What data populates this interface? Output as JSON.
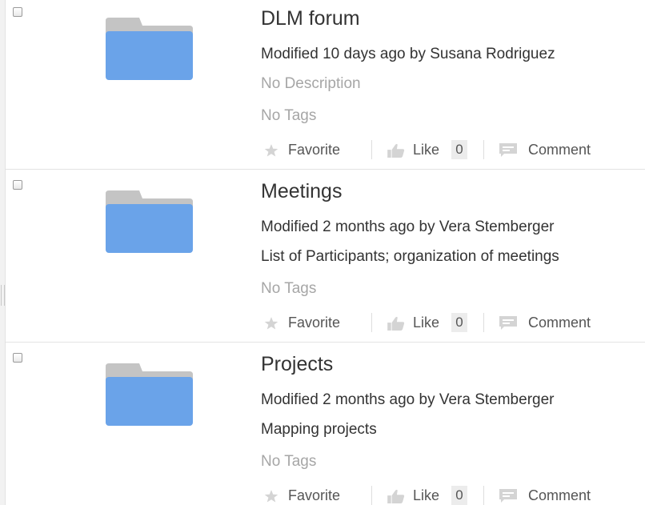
{
  "actions": {
    "favorite_label": "Favorite",
    "like_label": "Like",
    "comment_label": "Comment"
  },
  "colors": {
    "folder_front": "#6aa3e9",
    "folder_back": "#c4c4c4",
    "muted_text": "#a6a6a6"
  },
  "folders": [
    {
      "name": "DLM forum",
      "modified": "Modified 10 days ago by Susana Rodriguez",
      "description": "No Description",
      "tags": "No Tags",
      "like_count": "0"
    },
    {
      "name": "Meetings",
      "modified": "Modified 2 months ago by Vera Stemberger",
      "description": "List of Participants; organization of meetings",
      "tags": "No Tags",
      "like_count": "0"
    },
    {
      "name": "Projects",
      "modified": "Modified 2 months ago by Vera Stemberger",
      "description": "Mapping projects",
      "tags": "No Tags",
      "like_count": "0"
    }
  ]
}
